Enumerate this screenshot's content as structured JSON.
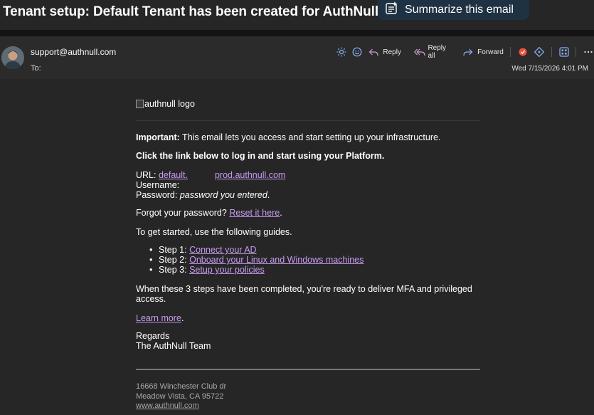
{
  "email": {
    "subject": "Tenant setup: Default Tenant has been created for AuthNull",
    "summarize_label": "Summarize this email",
    "sender": "support@authnull.com",
    "to_label": "To:",
    "date": "Wed 7/15/2026 4:01 PM"
  },
  "toolbar": {
    "reply": "Reply",
    "reply_all": "Reply all",
    "forward": "Forward"
  },
  "body": {
    "logo_alt": "authnull logo",
    "important_label": "Important:",
    "important_text": " This email lets you access and start setting up your infrastructure.",
    "click_text": "Click the link below to log in and start using your Platform.",
    "url_label": "URL: ",
    "url_link_part1": "default.",
    "url_link_part2": "prod.authnull.com",
    "username_label": "Username:",
    "password_label": "Password: ",
    "password_value": "password you entered",
    "password_end": ".",
    "forgot_text": "Forgot your password? ",
    "reset_link": "Reset it here",
    "reset_end": ".",
    "getting_started": "To get started, use the following guides.",
    "steps": [
      {
        "label": "Step 1: ",
        "link": "Connect your AD"
      },
      {
        "label": "Step 2: ",
        "link": "Onboard your Linux and Windows machines"
      },
      {
        "label": "Step 3: ",
        "link": "Setup your policies"
      }
    ],
    "completed_line1": "When these 3 steps have been completed, you're ready to deliver MFA and privileged",
    "completed_line2": "access.",
    "learn_more": "Learn more",
    "learn_more_end": ".",
    "regards": "Regards",
    "team": "The AuthNull Team"
  },
  "footer": {
    "address_line1": "16668 Winchester Club dr",
    "address_line2": "Meadow Vista, CA 95722",
    "website": "www.authnull.com"
  },
  "colors": {
    "background": "#262626",
    "header_bg": "#2b2b2b",
    "link": "#c79bf2",
    "summarize_bg": "#1f3244"
  }
}
